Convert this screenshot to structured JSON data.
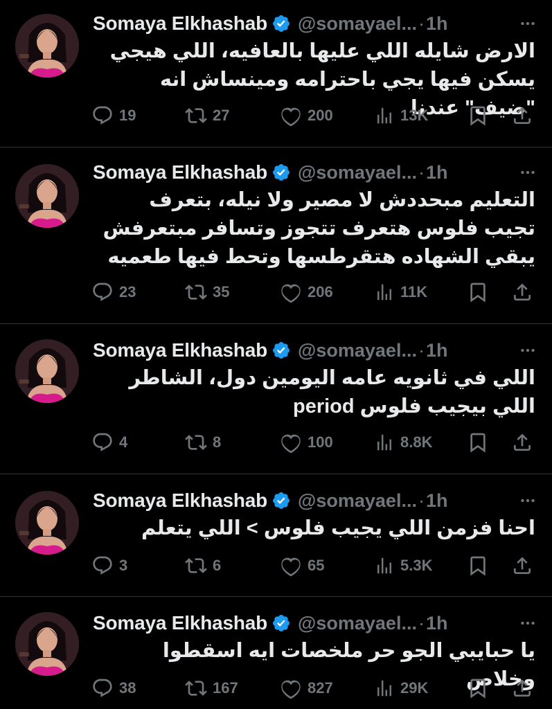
{
  "colors": {
    "background": "#000000",
    "text_primary": "#e7e9ea",
    "text_secondary": "#71767b",
    "verified_blue": "#1d9bf0",
    "divider": "#2f3336"
  },
  "icons": {
    "reply": "reply-icon",
    "retweet": "retweet-icon",
    "like": "heart-icon",
    "views": "views-icon",
    "bookmark": "bookmark-icon",
    "share": "share-icon",
    "more": "more-icon",
    "verified": "verified-badge-icon"
  },
  "tweets": [
    {
      "name": "Somaya Elkhashab",
      "handle": "@somayael...",
      "separator": "·",
      "time": "1h",
      "text": "الارض شايله اللي عليها بالعافيه، اللي هيجي يسكن فيها يجي باحترامه ومينساش انه \"ضيف\" عندنا",
      "replies": "19",
      "retweets": "27",
      "likes": "200",
      "views": "13K"
    },
    {
      "name": "Somaya Elkhashab",
      "handle": "@somayael...",
      "separator": "·",
      "time": "1h",
      "text": "التعليم مبحددش لا مصير ولا نيله، بتعرف تجيب فلوس هتعرف تتجوز وتسافر مبتعرفش يبقي الشهاده هتقرطسها وتحط فيها طعميه",
      "replies": "23",
      "retweets": "35",
      "likes": "206",
      "views": "11K"
    },
    {
      "name": "Somaya Elkhashab",
      "handle": "@somayael...",
      "separator": "·",
      "time": "1h",
      "text": "اللي في ثانويه عامه اليومين دول، الشاطر اللي بيجيب فلوس period",
      "replies": "4",
      "retweets": "8",
      "likes": "100",
      "views": "8.8K"
    },
    {
      "name": "Somaya Elkhashab",
      "handle": "@somayael...",
      "separator": "·",
      "time": "1h",
      "text": "احنا فزمن اللي يجيب فلوس > اللي يتعلم",
      "replies": "3",
      "retweets": "6",
      "likes": "65",
      "views": "5.3K"
    },
    {
      "name": "Somaya Elkhashab",
      "handle": "@somayael...",
      "separator": "·",
      "time": "1h",
      "text": "يا حبايبي الجو حر ملخصات ايه اسقطوا وخلاص",
      "replies": "38",
      "retweets": "167",
      "likes": "827",
      "views": "29K"
    }
  ]
}
